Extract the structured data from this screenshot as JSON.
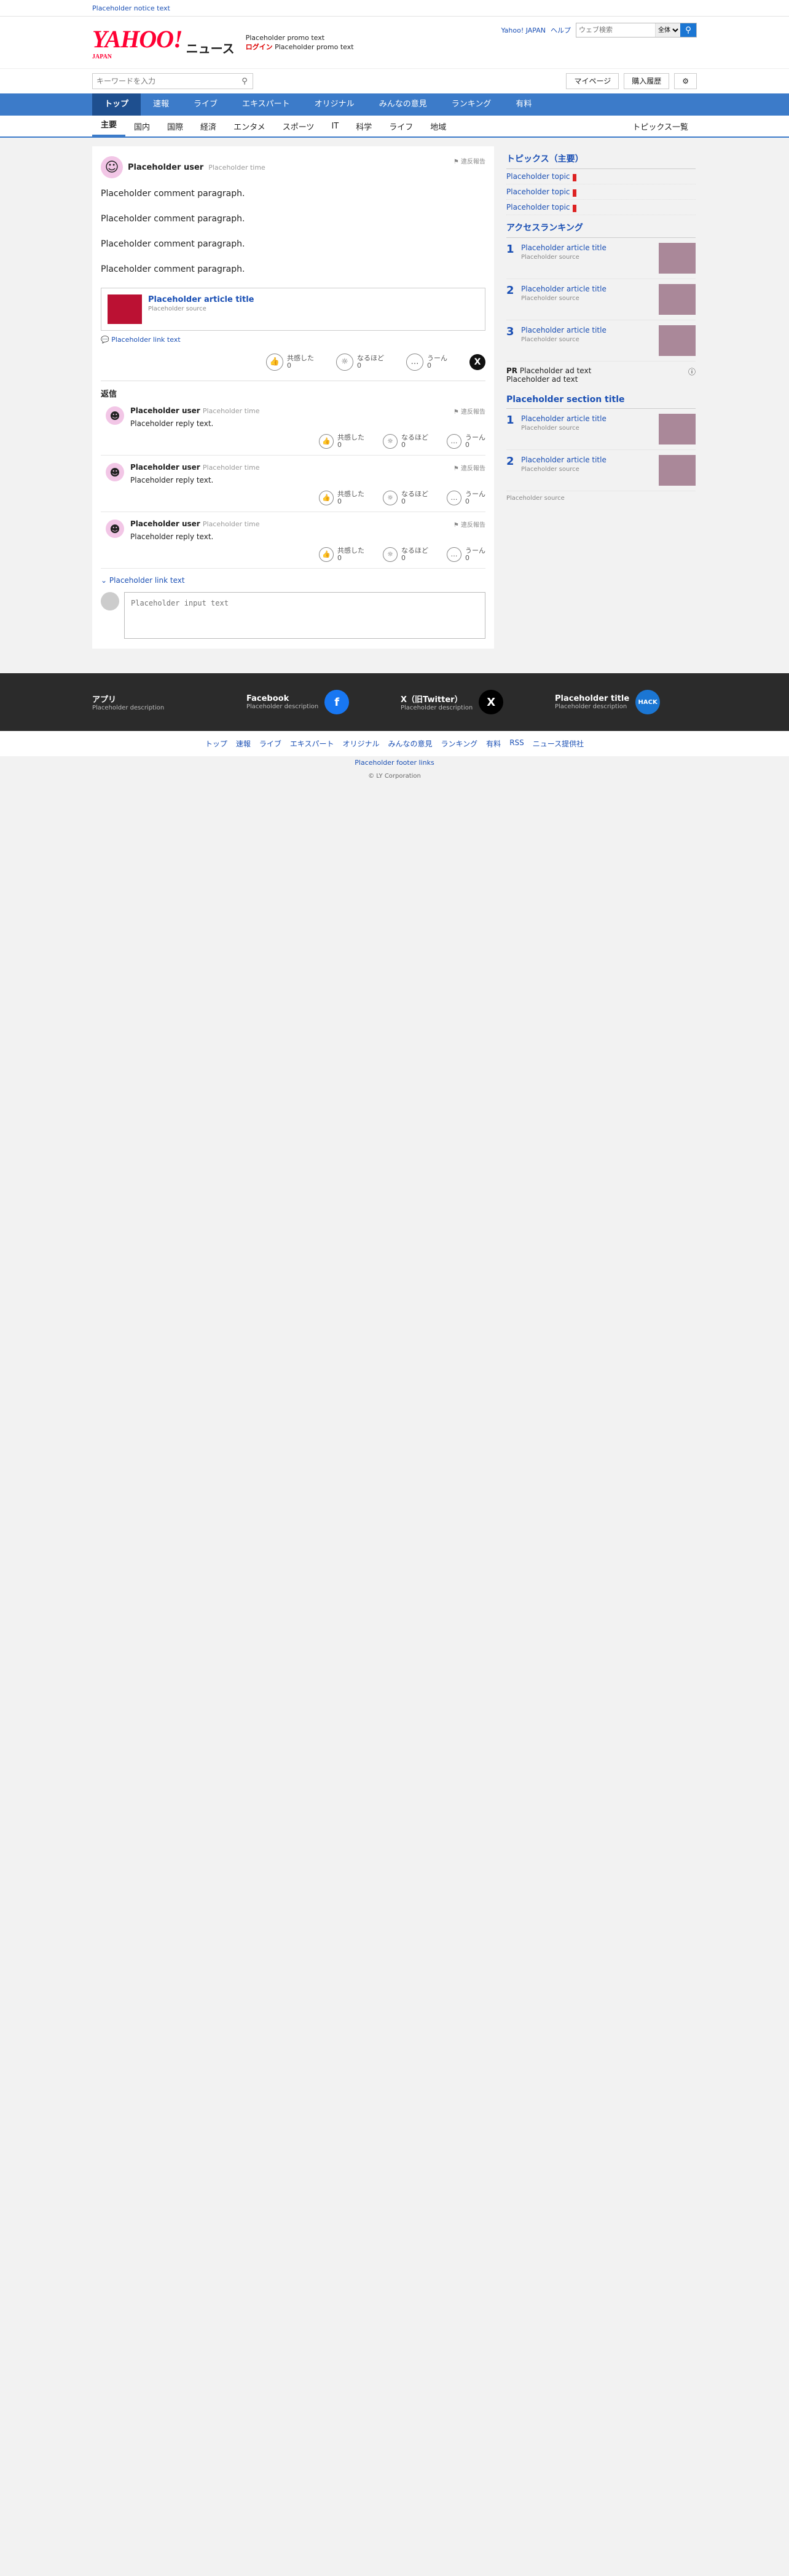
{
  "notice_bar": {
    "text": "Placeholder notice text"
  },
  "header": {
    "logo_yahoo": "YAHOO!",
    "logo_japan": "JAPAN",
    "logo_news": "ニュース",
    "promo_line1": "Placeholder promo text",
    "promo_login": "ログイン",
    "promo_line2": "Placeholder promo text",
    "links": [
      "Yahoo! JAPAN",
      "ヘルプ"
    ],
    "search_placeholder": "ウェブ検索",
    "search_select": "全体"
  },
  "search_row": {
    "placeholder": "キーワードを入力",
    "mypage": "マイページ",
    "history": "購入履歴"
  },
  "global_nav": [
    "トップ",
    "速報",
    "ライブ",
    "エキスパート",
    "オリジナル",
    "みんなの意見",
    "ランキング",
    "有料"
  ],
  "sub_nav": {
    "items": [
      "主要",
      "国内",
      "国際",
      "経済",
      "エンタメ",
      "スポーツ",
      "IT",
      "科学",
      "ライフ",
      "地域"
    ],
    "more": "トピックス一覧"
  },
  "comment": {
    "user": "Placeholder user",
    "time": "Placeholder time",
    "report": "違反報告",
    "paragraphs": [
      "Placeholder comment paragraph.",
      "Placeholder comment paragraph.",
      "Placeholder comment paragraph.",
      "Placeholder comment paragraph."
    ],
    "quote_title": "Placeholder article title",
    "quote_source": "Placeholder source",
    "quote_link": "Placeholder link text",
    "reactions": [
      {
        "label": "共感した",
        "count": "0"
      },
      {
        "label": "なるほど",
        "count": "0"
      },
      {
        "label": "うーん",
        "count": "0"
      }
    ]
  },
  "replies_label": "返信",
  "replies": [
    {
      "user": "Placeholder user",
      "time": "Placeholder time",
      "text": "Placeholder reply text.",
      "c": [
        "0",
        "0",
        "0"
      ]
    },
    {
      "user": "Placeholder user",
      "time": "Placeholder time",
      "text": "Placeholder reply text.",
      "c": [
        "0",
        "0",
        "0"
      ]
    },
    {
      "user": "Placeholder user",
      "time": "Placeholder time",
      "text": "Placeholder reply text.",
      "c": [
        "0",
        "0",
        "0"
      ]
    }
  ],
  "see_more": "Placeholder link text",
  "reply_placeholder": "Placeholder input text",
  "reaction_labels": [
    "共感した",
    "なるほど",
    "うーん"
  ],
  "side": {
    "topics_title": "トピックス（主要）",
    "topics": [
      {
        "text": "Placeholder topic",
        "badge": ""
      },
      {
        "text": "Placeholder topic",
        "badge": ""
      },
      {
        "text": "Placeholder topic",
        "badge": ""
      }
    ],
    "access_title": "アクセスランキング",
    "access": [
      {
        "n": "1",
        "title": "Placeholder article title",
        "src": "Placeholder source"
      },
      {
        "n": "2",
        "title": "Placeholder article title",
        "src": "Placeholder source"
      },
      {
        "n": "3",
        "title": "Placeholder article title",
        "src": "Placeholder source"
      }
    ],
    "pr_label": "PR",
    "pr_text": "Placeholder ad text",
    "pr_sub": "Placeholder ad text",
    "yahoo_title": "Placeholder section title",
    "yahoo_ranking": [
      {
        "n": "1",
        "title": "Placeholder article title",
        "src": "Placeholder source"
      },
      {
        "n": "2",
        "title": "Placeholder article title",
        "src": "Placeholder source"
      }
    ],
    "tbs_source": "Placeholder source"
  },
  "footer": {
    "blocks": [
      {
        "title": "アプリ",
        "desc": "Placeholder description"
      },
      {
        "title": "Facebook",
        "desc": "Placeholder description"
      },
      {
        "title": "X（旧Twitter）",
        "desc": "Placeholder description"
      },
      {
        "title": "Placeholder title",
        "desc": "Placeholder description"
      }
    ],
    "nav": [
      "トップ",
      "速報",
      "ライブ",
      "エキスパート",
      "オリジナル",
      "みんなの意見",
      "ランキング",
      "有料",
      "RSS",
      "ニュース提供社"
    ],
    "links": "Placeholder footer links",
    "copyright": "© LY Corporation"
  }
}
